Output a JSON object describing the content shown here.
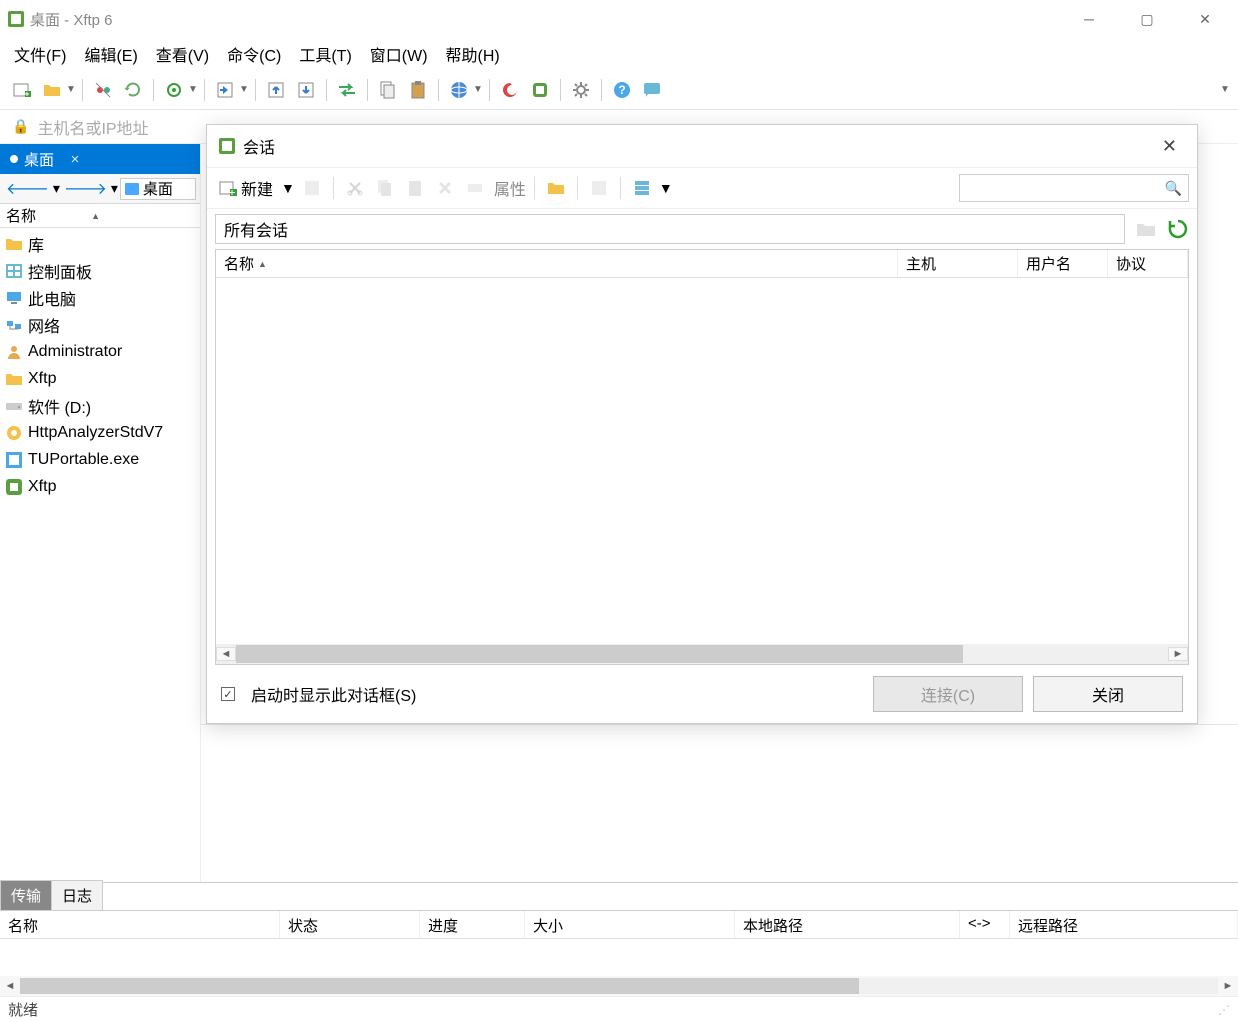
{
  "window": {
    "title": "桌面 - Xftp 6"
  },
  "menu": {
    "file": "文件(F)",
    "edit": "编辑(E)",
    "view": "查看(V)",
    "commands": "命令(C)",
    "tools": "工具(T)",
    "window": "窗口(W)",
    "help": "帮助(H)"
  },
  "address": {
    "placeholder": "主机名或IP地址"
  },
  "tab": {
    "label": "桌面"
  },
  "nav": {
    "path_label": "桌面"
  },
  "left_cols": {
    "name": "名称"
  },
  "files": [
    {
      "icon": "folder-yellow",
      "label": "库"
    },
    {
      "icon": "control-panel",
      "label": "控制面板"
    },
    {
      "icon": "pc",
      "label": "此电脑"
    },
    {
      "icon": "network",
      "label": "网络"
    },
    {
      "icon": "user",
      "label": "Administrator"
    },
    {
      "icon": "folder-yellow",
      "label": "Xftp"
    },
    {
      "icon": "drive",
      "label": "软件 (D:)"
    },
    {
      "icon": "app-http",
      "label": "HttpAnalyzerStdV7"
    },
    {
      "icon": "app-tu",
      "label": "TUPortable.exe"
    },
    {
      "icon": "xftp",
      "label": "Xftp"
    }
  ],
  "dialog": {
    "title": "会话",
    "new_label": "新建",
    "props_label": "属性",
    "breadcrumb": "所有会话",
    "cols": {
      "name": "名称",
      "host": "主机",
      "user": "用户名",
      "protocol": "协议"
    },
    "show_on_start": "启动时显示此对话框(S)",
    "connect": "连接(C)",
    "close": "关闭"
  },
  "bottom": {
    "tabs": {
      "transfer": "传输",
      "log": "日志"
    },
    "cols": {
      "name": "名称",
      "status": "状态",
      "progress": "进度",
      "size": "大小",
      "local": "本地路径",
      "arrow": "<->",
      "remote": "远程路径"
    },
    "status": "就绪"
  }
}
